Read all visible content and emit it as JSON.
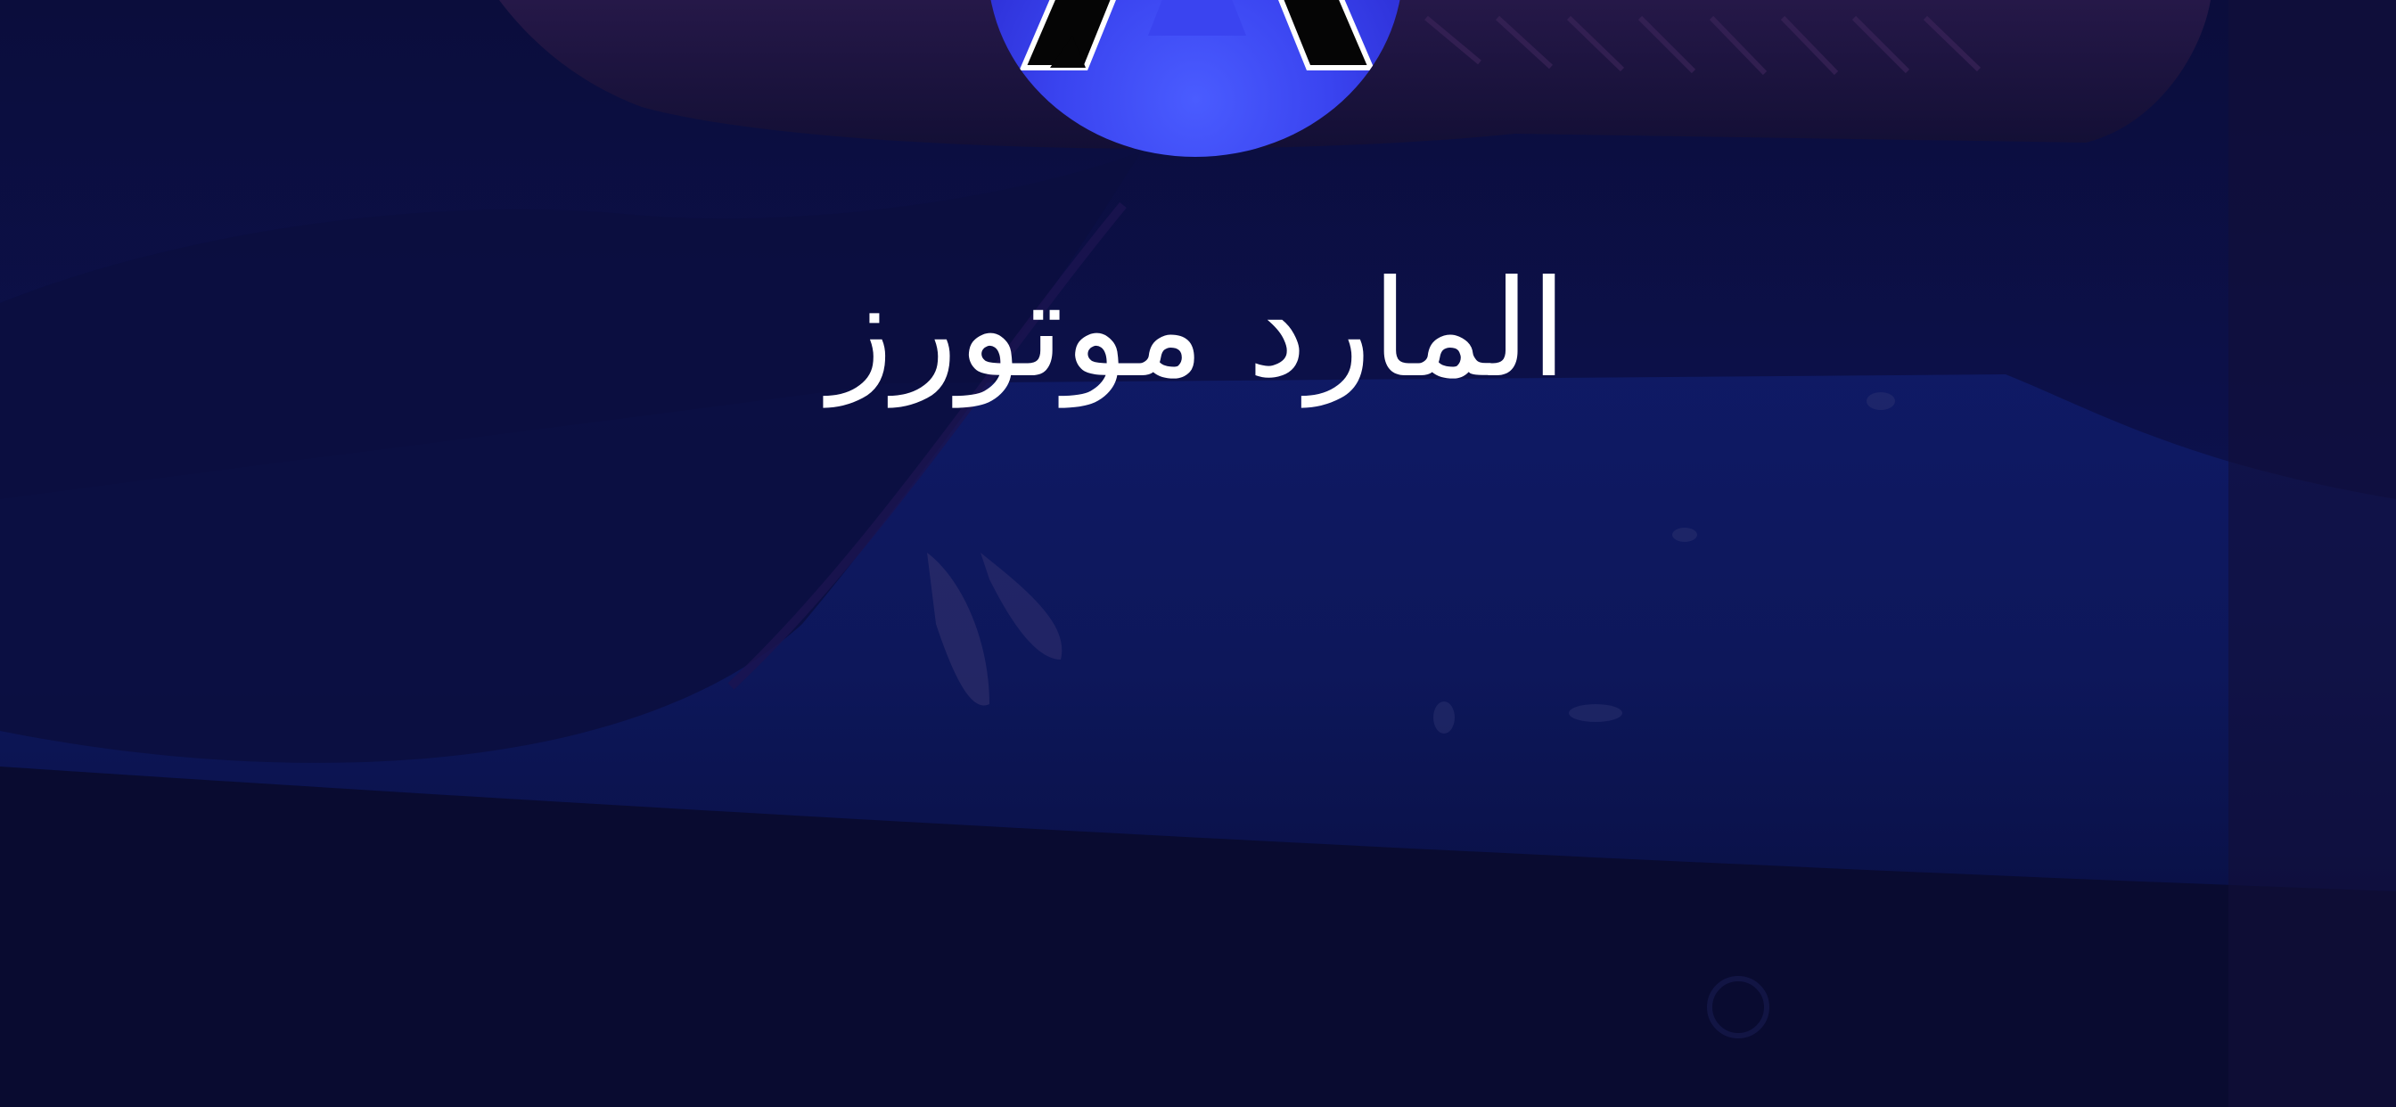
{
  "brand": {
    "name": "المارد موتورز",
    "logo_icon": "letter-a-badge-icon",
    "logo_color": "#3a44f0"
  },
  "background": {
    "description_icon": "car-bumper-photo",
    "overlay_color": "#0a0c33"
  }
}
